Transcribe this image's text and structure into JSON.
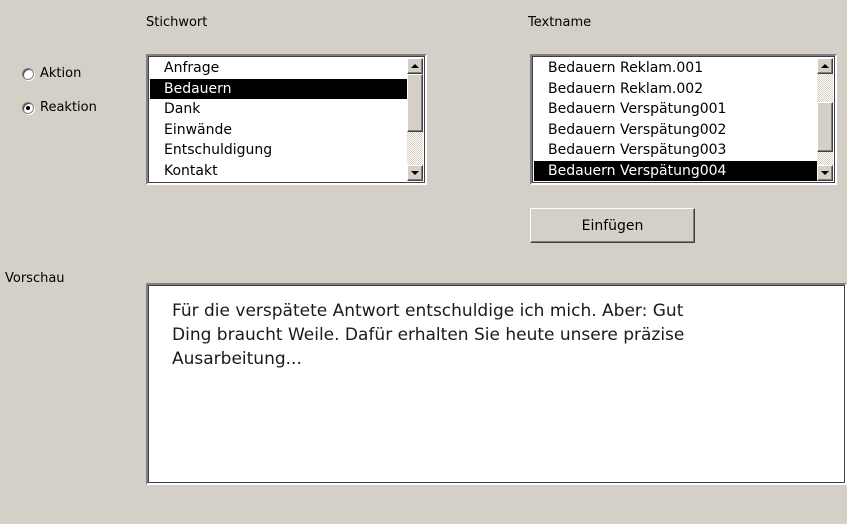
{
  "headers": {
    "keyword": "Stichwort",
    "textname": "Textname"
  },
  "mode": {
    "options": [
      {
        "label": "Aktion",
        "checked": false
      },
      {
        "label": "Reaktion",
        "checked": true
      }
    ]
  },
  "keyword_list": {
    "items": [
      {
        "label": "Anfrage",
        "selected": false
      },
      {
        "label": "Bedauern",
        "selected": true
      },
      {
        "label": "Dank",
        "selected": false
      },
      {
        "label": "Einwände",
        "selected": false
      },
      {
        "label": "Entschuldigung",
        "selected": false
      },
      {
        "label": "Kontakt",
        "selected": false
      }
    ]
  },
  "textname_list": {
    "items": [
      {
        "label": "Bedauern Reklam.001",
        "selected": false
      },
      {
        "label": "Bedauern Reklam.002",
        "selected": false
      },
      {
        "label": "Bedauern Verspätung001",
        "selected": false
      },
      {
        "label": "Bedauern Verspätung002",
        "selected": false
      },
      {
        "label": "Bedauern Verspätung003",
        "selected": false
      },
      {
        "label": "Bedauern Verspätung004",
        "selected": true
      }
    ]
  },
  "insert_button": {
    "label": "Einfügen"
  },
  "preview": {
    "label": "Vorschau",
    "text": "Für die verspätete Antwort entschuldige ich mich. Aber: Gut\nDing braucht Weile. Dafür erhalten Sie heute unsere präzise\nAusarbeitung..."
  }
}
